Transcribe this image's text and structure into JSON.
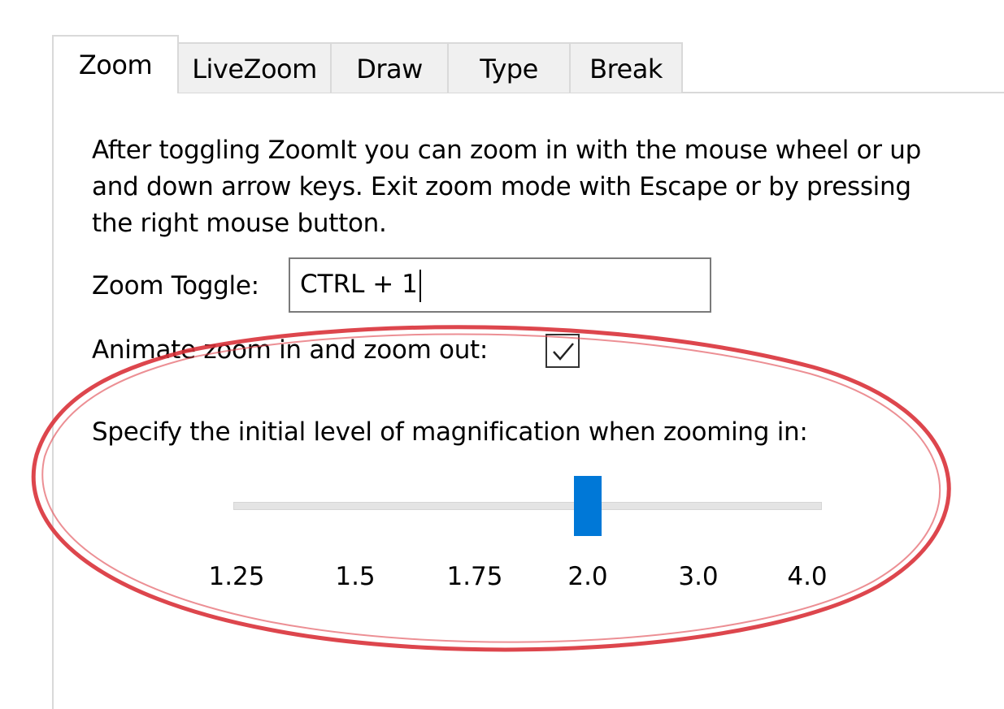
{
  "tabs": [
    {
      "label": "Zoom",
      "active": true
    },
    {
      "label": "LiveZoom",
      "active": false
    },
    {
      "label": "Draw",
      "active": false
    },
    {
      "label": "Type",
      "active": false
    },
    {
      "label": "Break",
      "active": false
    }
  ],
  "description": [
    "After toggling ZoomIt you can zoom in with the mouse wheel or up",
    "and down arrow keys. Exit zoom mode with Escape or by pressing",
    "the right mouse button."
  ],
  "zoom_toggle": {
    "label": "Zoom Toggle:",
    "value": "CTRL + 1"
  },
  "animate": {
    "label": "Animate zoom in and zoom out:",
    "checked": true
  },
  "magnification": {
    "label": "Specify the initial level of magnification when zooming in:",
    "ticks": [
      "1.25",
      "1.5",
      "1.75",
      "2.0",
      "3.0",
      "4.0"
    ],
    "selected": "2.0"
  },
  "annotation": {
    "shape": "hand-drawn-ellipse",
    "color": "#d9323a"
  },
  "colors": {
    "accent": "#0078d7",
    "tab_border": "#d9d9d9",
    "input_border": "#7a7a7a"
  }
}
